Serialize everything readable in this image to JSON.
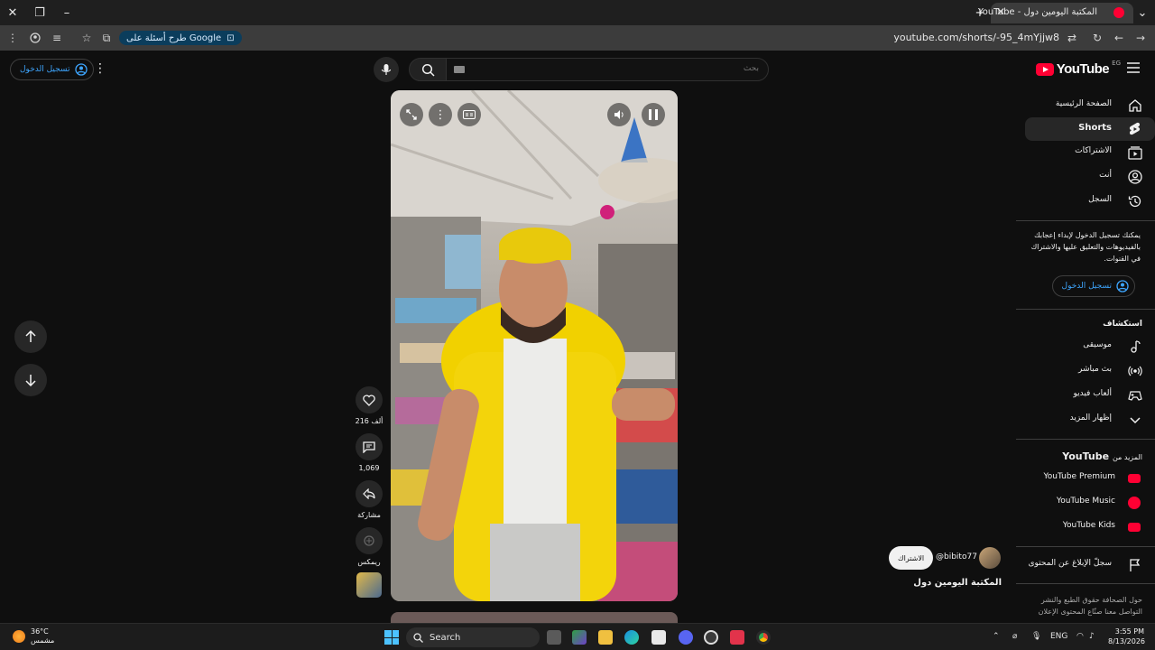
{
  "browser": {
    "tab_title": "المكتبة اليومين دول - YouTube",
    "url": "youtube.com/shorts/-95_4mYjjw8",
    "google_chip": "طرح أسئلة على Google"
  },
  "header": {
    "logo_text": "YouTube",
    "country_code": "EG",
    "search_placeholder": "بحث",
    "signin_label": "تسجيل الدخول"
  },
  "sidebar": {
    "items": [
      {
        "label": "الصفحة الرئيسية",
        "icon": "home-icon",
        "active": false
      },
      {
        "label": "Shorts",
        "icon": "shorts-icon",
        "active": true
      },
      {
        "label": "الاشتراكات",
        "icon": "subscriptions-icon",
        "active": false
      },
      {
        "label": "أنت",
        "icon": "you-icon",
        "active": false
      },
      {
        "label": "السجل",
        "icon": "history-icon",
        "active": false
      }
    ],
    "signin_message": "يمكنك تسجيل الدخول لإبداء إعجابك بالفيديوهات والتعليق عليها والاشتراك في القنوات.",
    "signin_button": "تسجيل الدخول",
    "explore_heading": "استكشاف",
    "explore": [
      {
        "label": "موسيقى",
        "icon": "music-icon"
      },
      {
        "label": "بث مباشر",
        "icon": "live-icon"
      },
      {
        "label": "ألعاب فيديو",
        "icon": "gaming-icon"
      },
      {
        "label": "إظهار المزيد",
        "icon": "chevron-down-icon"
      }
    ],
    "more_heading_prefix": "المزيد من",
    "more_heading_brand": "YouTube",
    "more": [
      {
        "label": "YouTube Premium",
        "color": "#ff0033"
      },
      {
        "label": "YouTube Music",
        "color": "#ff0033"
      },
      {
        "label": "YouTube Kids",
        "color": "#ff0033"
      }
    ],
    "report_label": "سجلّ الإبلاغ عن المحتوى",
    "footer": "حول  الصحافة  حقوق الطبع والنشر  التواصل معنا  صنّاع المحتوى  الإعلان"
  },
  "short": {
    "likes": "216 ألف",
    "comments": "1,069",
    "share_label": "مشاركة",
    "remix_label": "ريمكس",
    "channel_handle": "@bibito77",
    "subscribe_label": "الاشتراك",
    "title": "المكتبة اليومين دول"
  },
  "taskbar": {
    "temperature": "36°C",
    "weather": "مشمس",
    "search_label": "Search",
    "language": "ENG",
    "time": "3:55 PM",
    "date": "8/13/2026"
  },
  "colors": {
    "accent": "#3ea6ff",
    "brand": "#ff0033",
    "background": "#0f0f0f"
  }
}
